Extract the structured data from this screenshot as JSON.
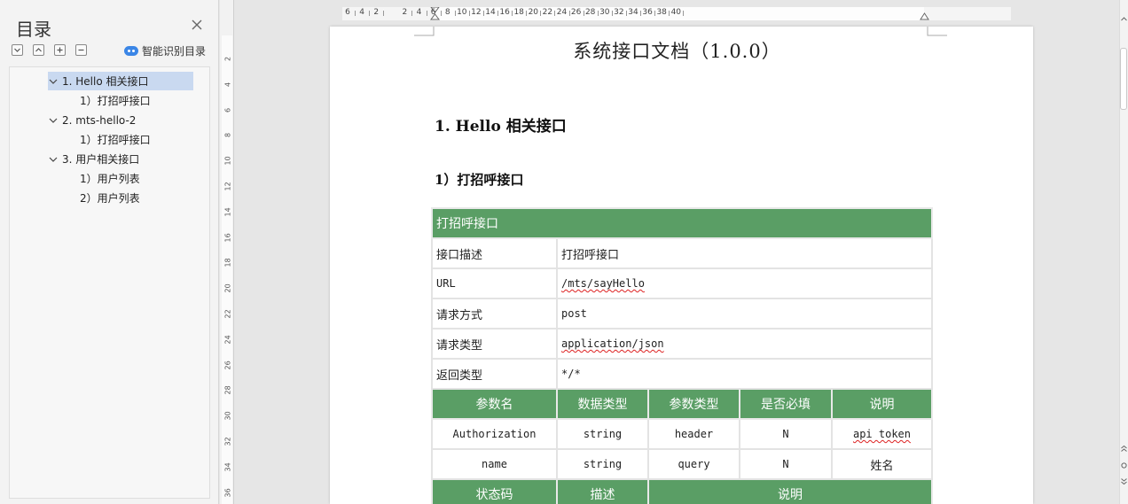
{
  "sidebar": {
    "title": "目录",
    "smart_toc_label": "智能识别目录",
    "tools": [
      "collapse-all-icon",
      "expand-level-icon",
      "add-icon",
      "remove-icon"
    ],
    "items": [
      {
        "label": "1. Hello 相关接口",
        "level": 1,
        "selected": true
      },
      {
        "label": "1）打招呼接口",
        "level": 2
      },
      {
        "label": "2. mts-hello-2",
        "level": 1
      },
      {
        "label": "1）打招呼接口",
        "level": 2
      },
      {
        "label": "3. 用户相关接口",
        "level": 1
      },
      {
        "label": "1）用户列表",
        "level": 2
      },
      {
        "label": "2）用户列表",
        "level": 2
      }
    ]
  },
  "ruler": {
    "h_numbers": [
      "6",
      "4",
      "2",
      "2",
      "4",
      "6",
      "8",
      "10",
      "12",
      "14",
      "16",
      "18",
      "20",
      "22",
      "24",
      "26",
      "28",
      "30",
      "32",
      "34",
      "36",
      "38",
      "40"
    ],
    "v_numbers": [
      "2",
      "4",
      "6",
      "8",
      "10",
      "12",
      "14",
      "16",
      "18",
      "20",
      "22",
      "24",
      "26",
      "28",
      "30",
      "32",
      "34",
      "36"
    ]
  },
  "document": {
    "title": "系统接口文档（1.0.0）",
    "heading1": "1. Hello 相关接口",
    "heading2": "1）打招呼接口",
    "table": {
      "header": "打招呼接口",
      "info_rows": [
        {
          "label": "接口描述",
          "value": "打招呼接口"
        },
        {
          "label": "URL",
          "value": "/mts/sayHello"
        },
        {
          "label": "请求方式",
          "value": "post"
        },
        {
          "label": "请求类型",
          "value": "application/json"
        },
        {
          "label": "返回类型",
          "value": "*/*"
        }
      ],
      "param_headers": [
        "参数名",
        "数据类型",
        "参数类型",
        "是否必填",
        "说明"
      ],
      "params": [
        [
          "Authorization",
          "string",
          "header",
          "N",
          "api token"
        ],
        [
          "name",
          "string",
          "query",
          "N",
          "姓名"
        ]
      ],
      "response_headers": [
        "状态码",
        "描述",
        "说明"
      ]
    }
  },
  "colors": {
    "table_header": "#5a9e65",
    "toc_selected": "#c9d9f0",
    "smart_toc_icon": "#3b86e6"
  }
}
